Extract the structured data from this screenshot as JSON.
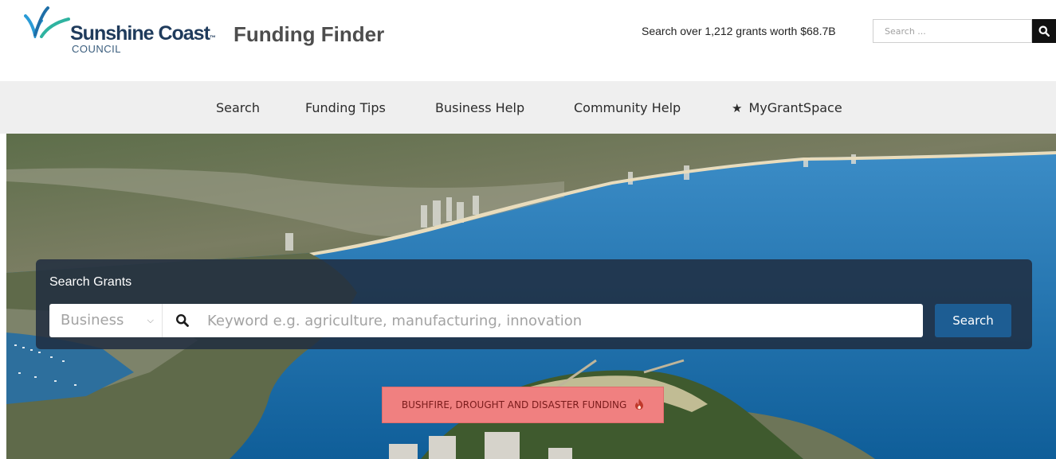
{
  "header": {
    "logo": {
      "name": "Sunshine Coast",
      "tm": "™",
      "sub": "COUNCIL"
    },
    "site_title": "Funding Finder",
    "grant_stats": "Search over 1,212 grants worth $68.7B",
    "search_placeholder": "Search ...",
    "search_icon": "search-icon"
  },
  "nav": {
    "items": [
      {
        "label": "Search"
      },
      {
        "label": "Funding Tips"
      },
      {
        "label": "Business Help"
      },
      {
        "label": "Community Help"
      },
      {
        "label": "MyGrantSpace",
        "icon": "star-icon"
      }
    ]
  },
  "hero": {
    "panel_title": "Search Grants",
    "type_select": {
      "selected": "Business"
    },
    "keyword_placeholder": "Keyword e.g. agriculture, manufacturing, innovation",
    "search_button": "Search",
    "disaster_button": "BUSHFIRE, DROUGHT AND DISASTER FUNDING",
    "disaster_icon": "flame-icon"
  },
  "colors": {
    "nav_bg": "#efefef",
    "panel_bg": "#202d40",
    "search_button": "#1d5d93",
    "disaster_button": "#f08080",
    "brand_navy": "#1f3b5c"
  }
}
